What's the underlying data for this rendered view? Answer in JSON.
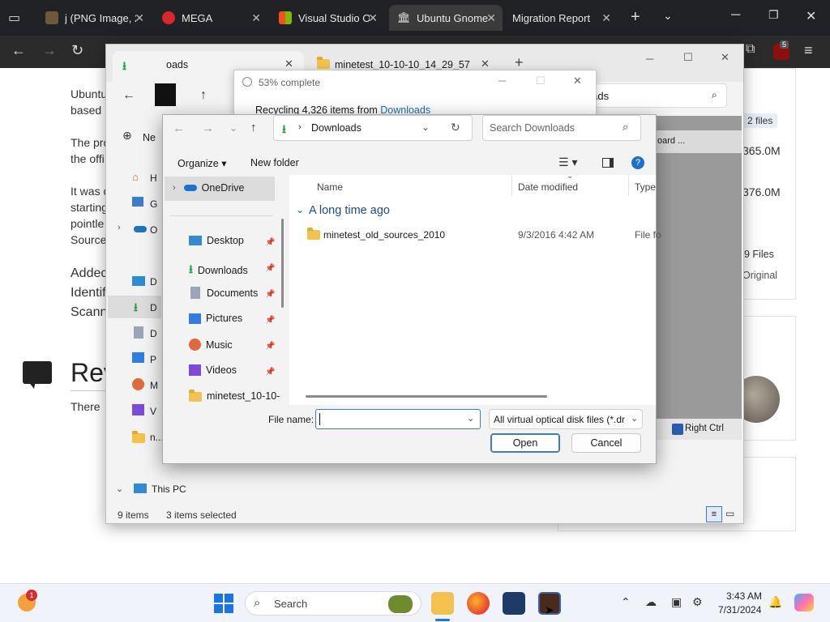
{
  "browser": {
    "tabs": [
      {
        "title": "j (PNG Image, 2",
        "active": false
      },
      {
        "title": "MEGA",
        "active": false
      },
      {
        "title": "Visual Studio Or",
        "active": false
      },
      {
        "title": "Ubuntu Gnome",
        "active": true
      },
      {
        "title": "Migration Report",
        "active": false
      }
    ],
    "new_tab": "+",
    "extension_badge": "5"
  },
  "webpage": {
    "para1": [
      "Ubuntu",
      "based"
    ],
    "para2": [
      "The pro",
      "the offi"
    ],
    "para3": [
      "It was c",
      "starting",
      "pointle",
      "Source"
    ],
    "para4": [
      "Addec",
      "Identif",
      "Scann"
    ],
    "reviews_heading": "Rev",
    "reviews_text": "There",
    "right": {
      "files_badge": "2 files",
      "size1": "365.0M",
      "size2": "376.0M",
      "files_count": "9 Files",
      "original": "Original",
      "search_partial": "loads",
      "board_partial": "oard ...",
      "right_ctrl": "Right Ctrl"
    }
  },
  "explorer": {
    "tab_title": "oads",
    "tab2_title": "minetest_10-10-10_14_29_57",
    "sidebar": [
      "H",
      "G",
      "O",
      "D",
      "D",
      "D",
      "P",
      "M",
      "V",
      "n..."
    ],
    "new_label": "Ne",
    "this_pc": "This PC",
    "status_items": "9 items",
    "status_selected": "3 items selected"
  },
  "progress": {
    "title": "53% complete",
    "message": "Recycling 4,326 items from",
    "source_link": "Downloads"
  },
  "open_dialog": {
    "breadcrumb": "Downloads",
    "search_placeholder": "Search Downloads",
    "organize": "Organize",
    "new_folder": "New folder",
    "nav": {
      "onedrive": "OneDrive",
      "desktop": "Desktop",
      "downloads": "Downloads",
      "documents": "Documents",
      "pictures": "Pictures",
      "music": "Music",
      "videos": "Videos",
      "minetest": "minetest_10-10-"
    },
    "columns": {
      "name": "Name",
      "date": "Date modified",
      "type": "Type"
    },
    "group": "A long time ago",
    "files": [
      {
        "name": "minetest_old_sources_2010",
        "date": "9/3/2016 4:42 AM",
        "type": "File fo"
      }
    ],
    "filename_label": "File name:",
    "filename_value": "",
    "filter": "All virtual optical disk files (*.dr",
    "open_button": "Open",
    "cancel_button": "Cancel"
  },
  "taskbar": {
    "search_placeholder": "Search",
    "time": "3:43 AM",
    "date": "7/31/2024",
    "weather_badge": "1"
  }
}
